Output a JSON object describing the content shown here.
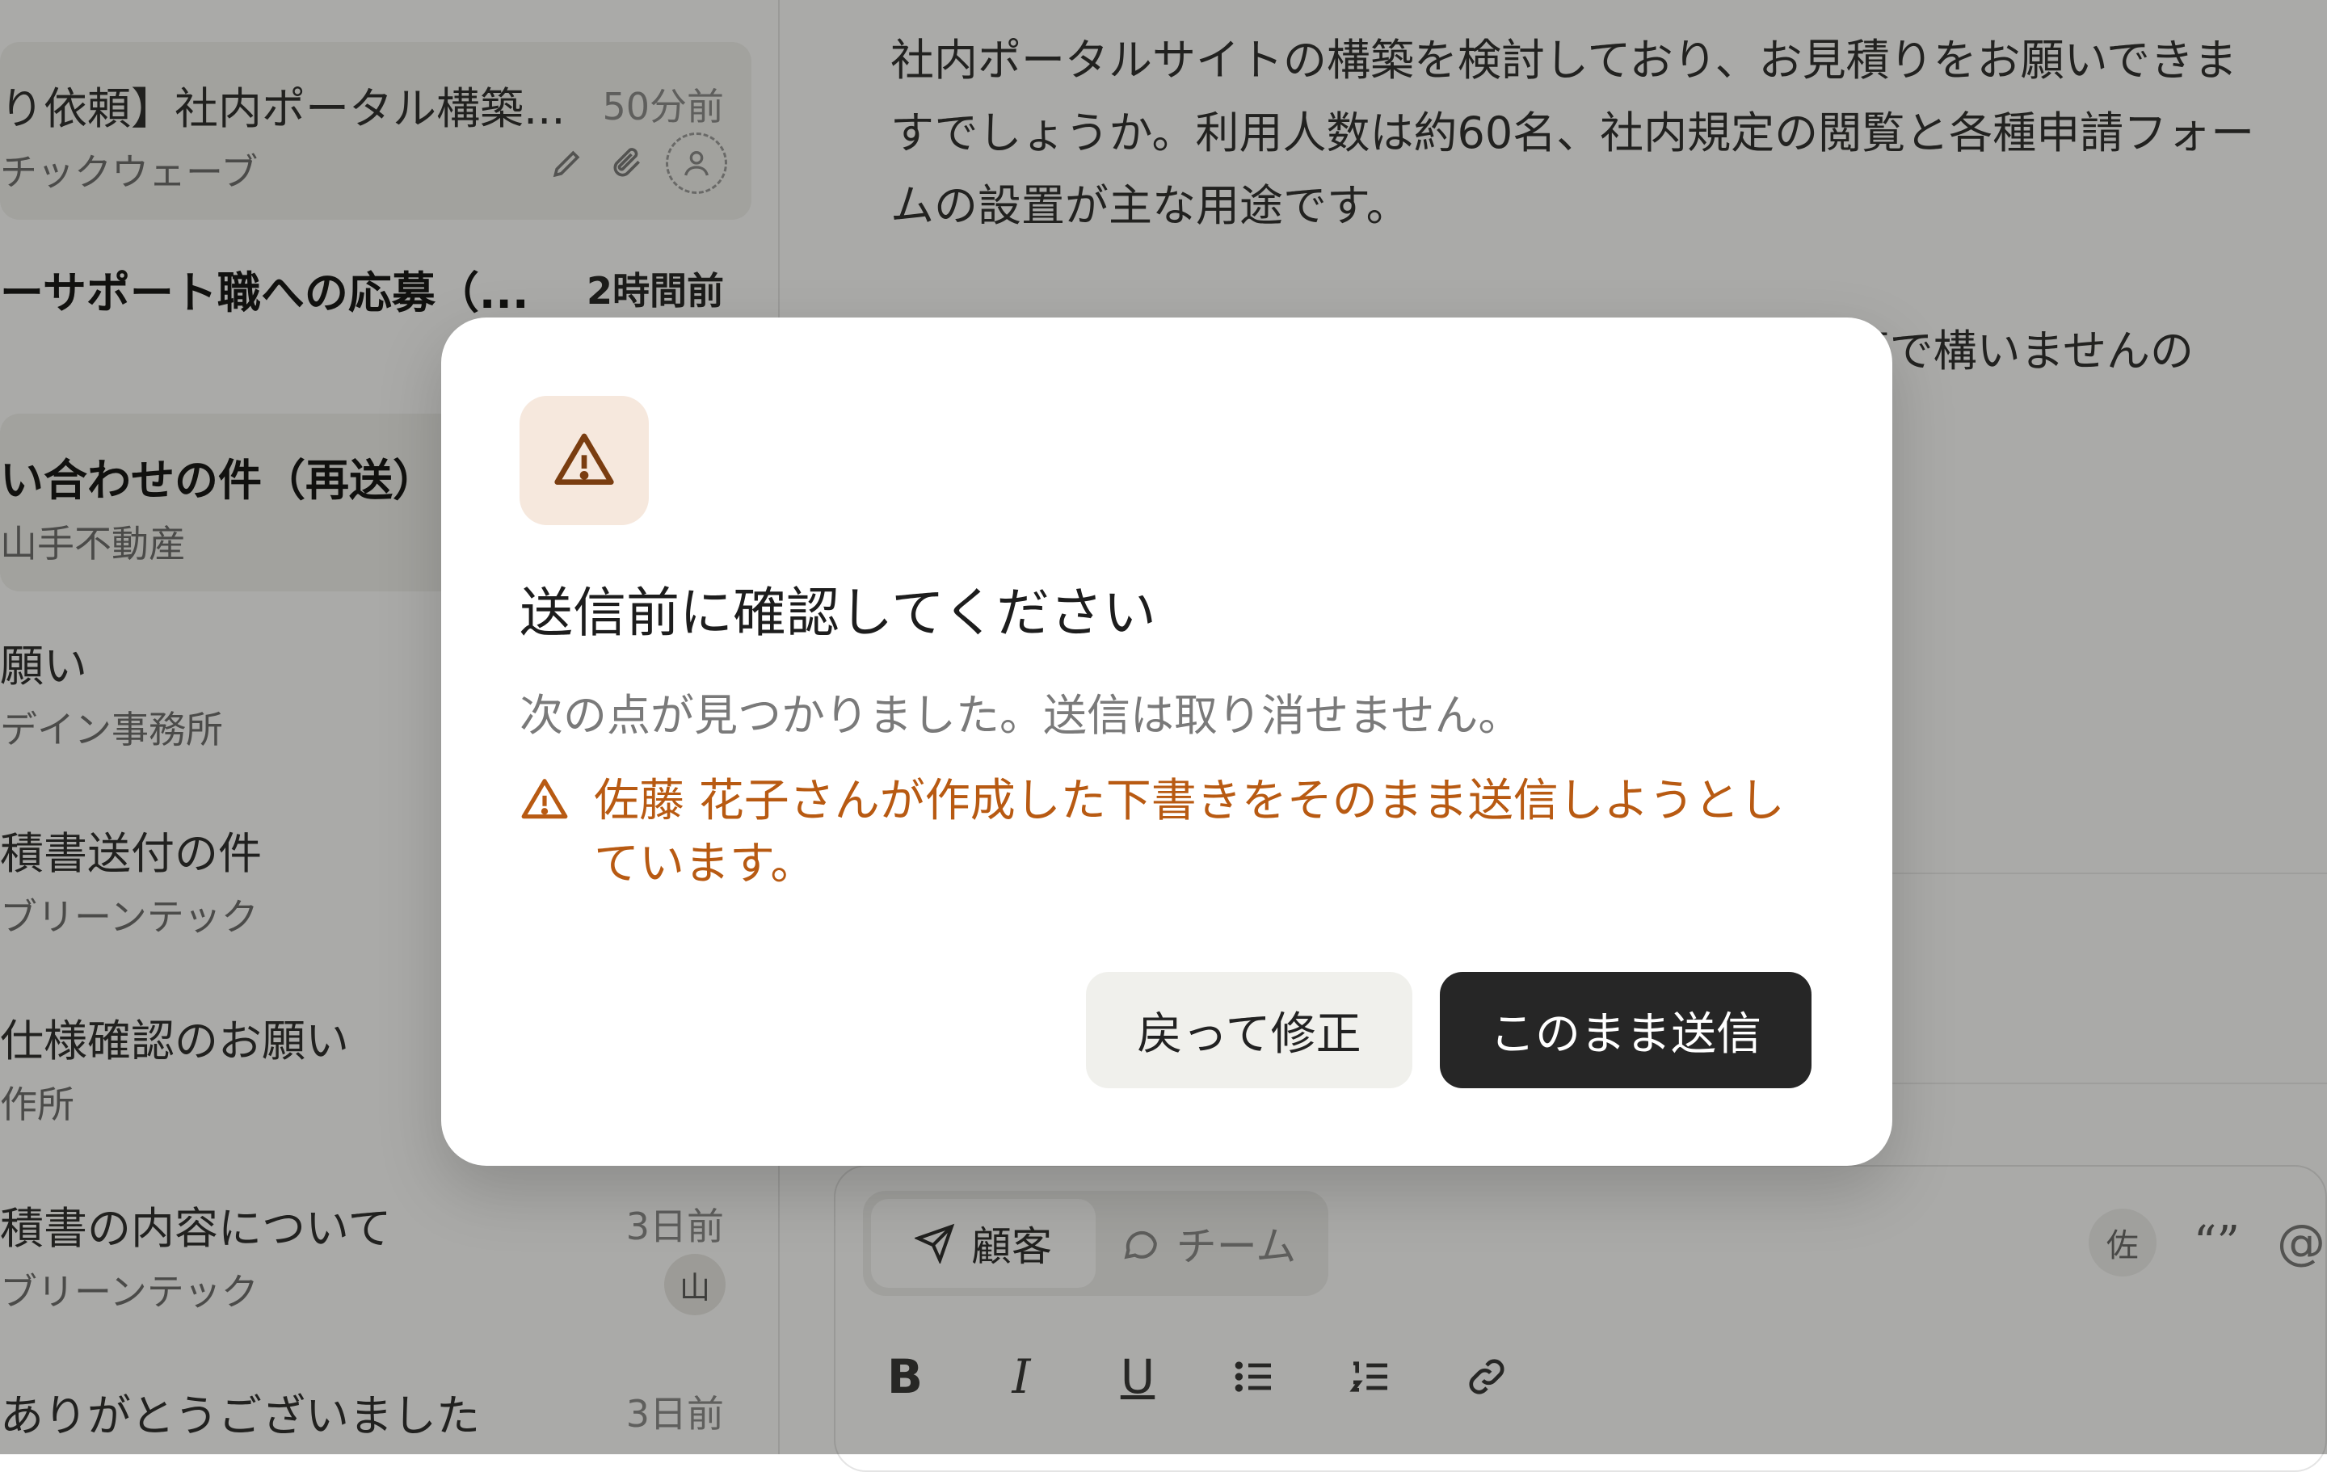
{
  "conversations": [
    {
      "subject": "り依頼】社内ポータル構築...",
      "from": "チックウェーブ",
      "time": "50分前",
      "unread": false,
      "selected": true
    },
    {
      "subject": "ーサポート職への応募（...",
      "from": "",
      "time": "2時間前",
      "unread": true,
      "selected": false
    },
    {
      "subject": "い合わせの件（再送）",
      "from": "山手不動産",
      "time": "",
      "unread": true,
      "selected": false
    },
    {
      "subject": "願い",
      "from": "デイン事務所",
      "time": "",
      "unread": false,
      "selected": false
    },
    {
      "subject": "積書送付の件",
      "from": "ブリーンテック",
      "time": "",
      "unread": false,
      "selected": false
    },
    {
      "subject": "仕様確認のお願い",
      "from": "作所",
      "time": "",
      "unread": false,
      "selected": false
    },
    {
      "subject": "積書の内容について",
      "from": "ブリーンテック",
      "time": "3日前",
      "unread": false,
      "selected": false,
      "assignee": "山"
    },
    {
      "subject": "ありがとうございました",
      "from": "",
      "time": "3日前",
      "unread": false,
      "selected": false
    }
  ],
  "message": {
    "paragraph1_line1": "社内ポータルサイトの構築を検討しており、お見積りをお願いできま",
    "paragraph1_line2": "すでしょうか。利用人数は約60名、社内規定の閲覧と各種申請フォー",
    "paragraph1_line3": "ムの設置が主な用途です。",
    "paragraph2_line1": "要件の概要をまとめた資料を添付いたします。概算で構いませんの"
  },
  "composer": {
    "mode_customer": "顧客",
    "mode_team": "チーム",
    "author_badge": "佐",
    "quote_glyph": "“”",
    "at_glyph": "@"
  },
  "dialog": {
    "title": "送信前に確認してください",
    "description": "次の点が見つかりました。送信は取り消せません。",
    "warning": "佐藤 花子さんが作成した下書きをそのまま送信しようとしています。",
    "back_label": "戻って修正",
    "send_label": "このまま送信"
  },
  "colors": {
    "warning": "#b85a12",
    "warning_tile": "#f6e8dd",
    "primary_button": "#262626",
    "secondary_button": "#f0f0ec"
  }
}
